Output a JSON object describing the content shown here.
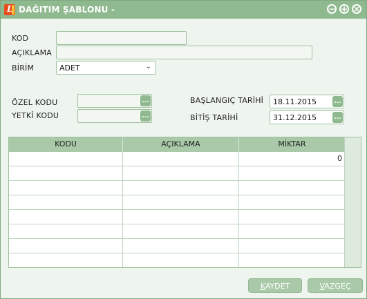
{
  "window": {
    "title": "DAĞITIM ŞABLONU -",
    "buttons": {
      "minimize": "−",
      "maximize": "+",
      "close": "×"
    }
  },
  "form": {
    "kod_label": "KOD",
    "kod_value": "",
    "aciklama_label": "AÇIKLAMA",
    "aciklama_value": "",
    "birim_label": "BİRİM",
    "birim_value": "ADET",
    "ozel_kodu_label": "ÖZEL KODU",
    "ozel_kodu_value": "",
    "yetki_kodu_label": "YETKİ KODU",
    "yetki_kodu_value": "",
    "baslangic_label": "BAŞLANGIÇ TARİHİ",
    "baslangic_value": "18.11.2015",
    "bitis_label": "BİTİŞ TARİHİ",
    "bitis_value": "31.12.2015",
    "lookup_glyph": "..."
  },
  "grid": {
    "columns": [
      "KODU",
      "AÇIKLAMA",
      "MİKTAR"
    ],
    "rows": [
      [
        "",
        "",
        "0"
      ],
      [
        "",
        "",
        ""
      ],
      [
        "",
        "",
        ""
      ],
      [
        "",
        "",
        ""
      ],
      [
        "",
        "",
        ""
      ],
      [
        "",
        "",
        ""
      ],
      [
        "",
        "",
        ""
      ],
      [
        "",
        "",
        ""
      ]
    ]
  },
  "footer": {
    "kaydet_first": "K",
    "kaydet_rest": "AYDET",
    "vazgec_first": "V",
    "vazgec_rest": "AZGEÇ"
  },
  "colors": {
    "accent": "#8fb98f",
    "header": "#a9c9a9",
    "brand_icon": "#e74c1e"
  }
}
